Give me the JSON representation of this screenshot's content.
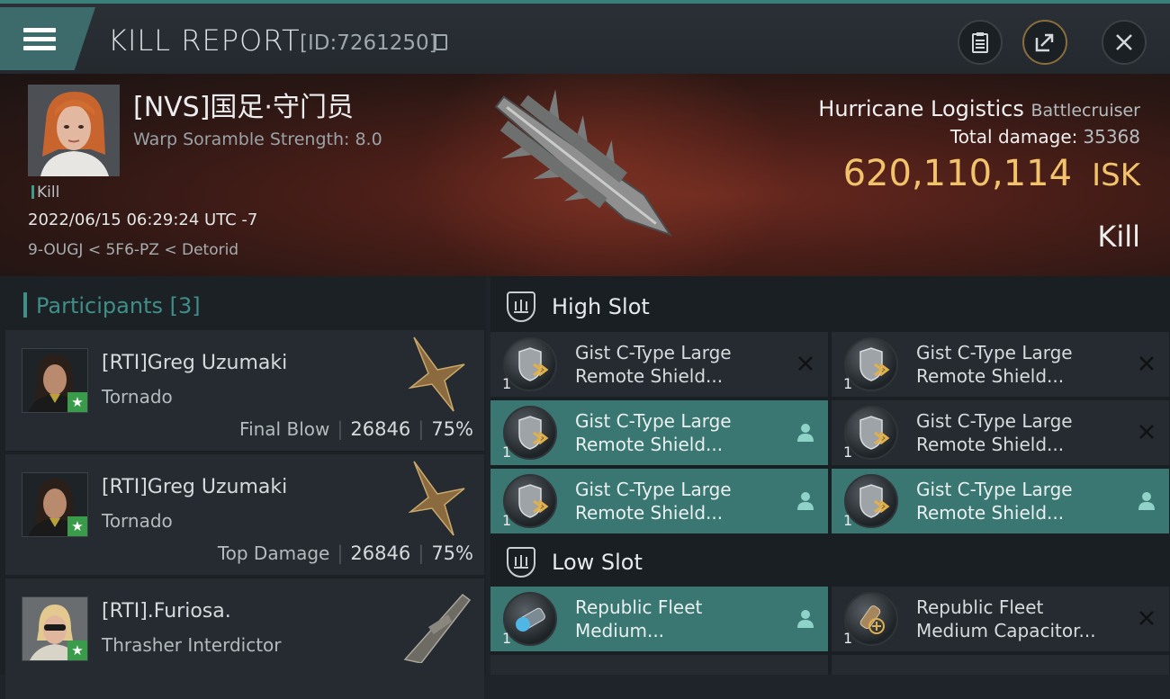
{
  "header": {
    "title": "KILL REPORT",
    "report_id": "[ID:7261250]"
  },
  "victim": {
    "name": "[NVS]国足·守门员",
    "scramble": "Warp Soramble Strength: 8.0",
    "tag": "Kill",
    "datetime": "2022/06/15 06:29:24 UTC -7",
    "location": "9-OUGJ < 5F6-PZ < Detorid",
    "ship": "Hurricane Logistics",
    "ship_class": "Battlecruiser",
    "total_damage_label": "Total damage:",
    "total_damage": "35368",
    "isk_value": "620,110,114",
    "isk_unit": "ISK",
    "result": "Kill"
  },
  "participants": {
    "title": "Participants",
    "count": "[3]",
    "rows": [
      {
        "name": "[RTI]Greg Uzumaki",
        "ship": "Tornado",
        "label": "Final Blow",
        "damage": "26846",
        "percent": "75%"
      },
      {
        "name": "[RTI]Greg Uzumaki",
        "ship": "Tornado",
        "label": "Top Damage",
        "damage": "26846",
        "percent": "75%"
      },
      {
        "name": "[RTI].Furiosa.",
        "ship": "Thrasher Interdictor"
      }
    ]
  },
  "fitting": {
    "high_slot_label": "High Slot",
    "low_slot_label": "Low Slot",
    "high": [
      {
        "line1": "Gist C-Type Large",
        "line2": "Remote Shield...",
        "qty": "1",
        "state": "destroyed"
      },
      {
        "line1": "Gist C-Type Large",
        "line2": "Remote Shield...",
        "qty": "1",
        "state": "destroyed"
      },
      {
        "line1": "Gist C-Type Large",
        "line2": "Remote Shield...",
        "qty": "1",
        "state": "dropped"
      },
      {
        "line1": "Gist C-Type Large",
        "line2": "Remote Shield...",
        "qty": "1",
        "state": "destroyed"
      },
      {
        "line1": "Gist C-Type Large",
        "line2": "Remote Shield...",
        "qty": "1",
        "state": "dropped"
      },
      {
        "line1": "Gist C-Type Large",
        "line2": "Remote Shield...",
        "qty": "1",
        "state": "dropped"
      }
    ],
    "low": [
      {
        "line1": "Republic Fleet",
        "line2": "Medium...",
        "qty": "1",
        "state": "dropped"
      },
      {
        "line1": "Republic Fleet",
        "line2": "Medium Capacitor...",
        "qty": "1",
        "state": "destroyed"
      }
    ]
  },
  "colors": {
    "accent": "#3a7772",
    "isk": "#f2c36b",
    "teal_text": "#3f8e88"
  }
}
